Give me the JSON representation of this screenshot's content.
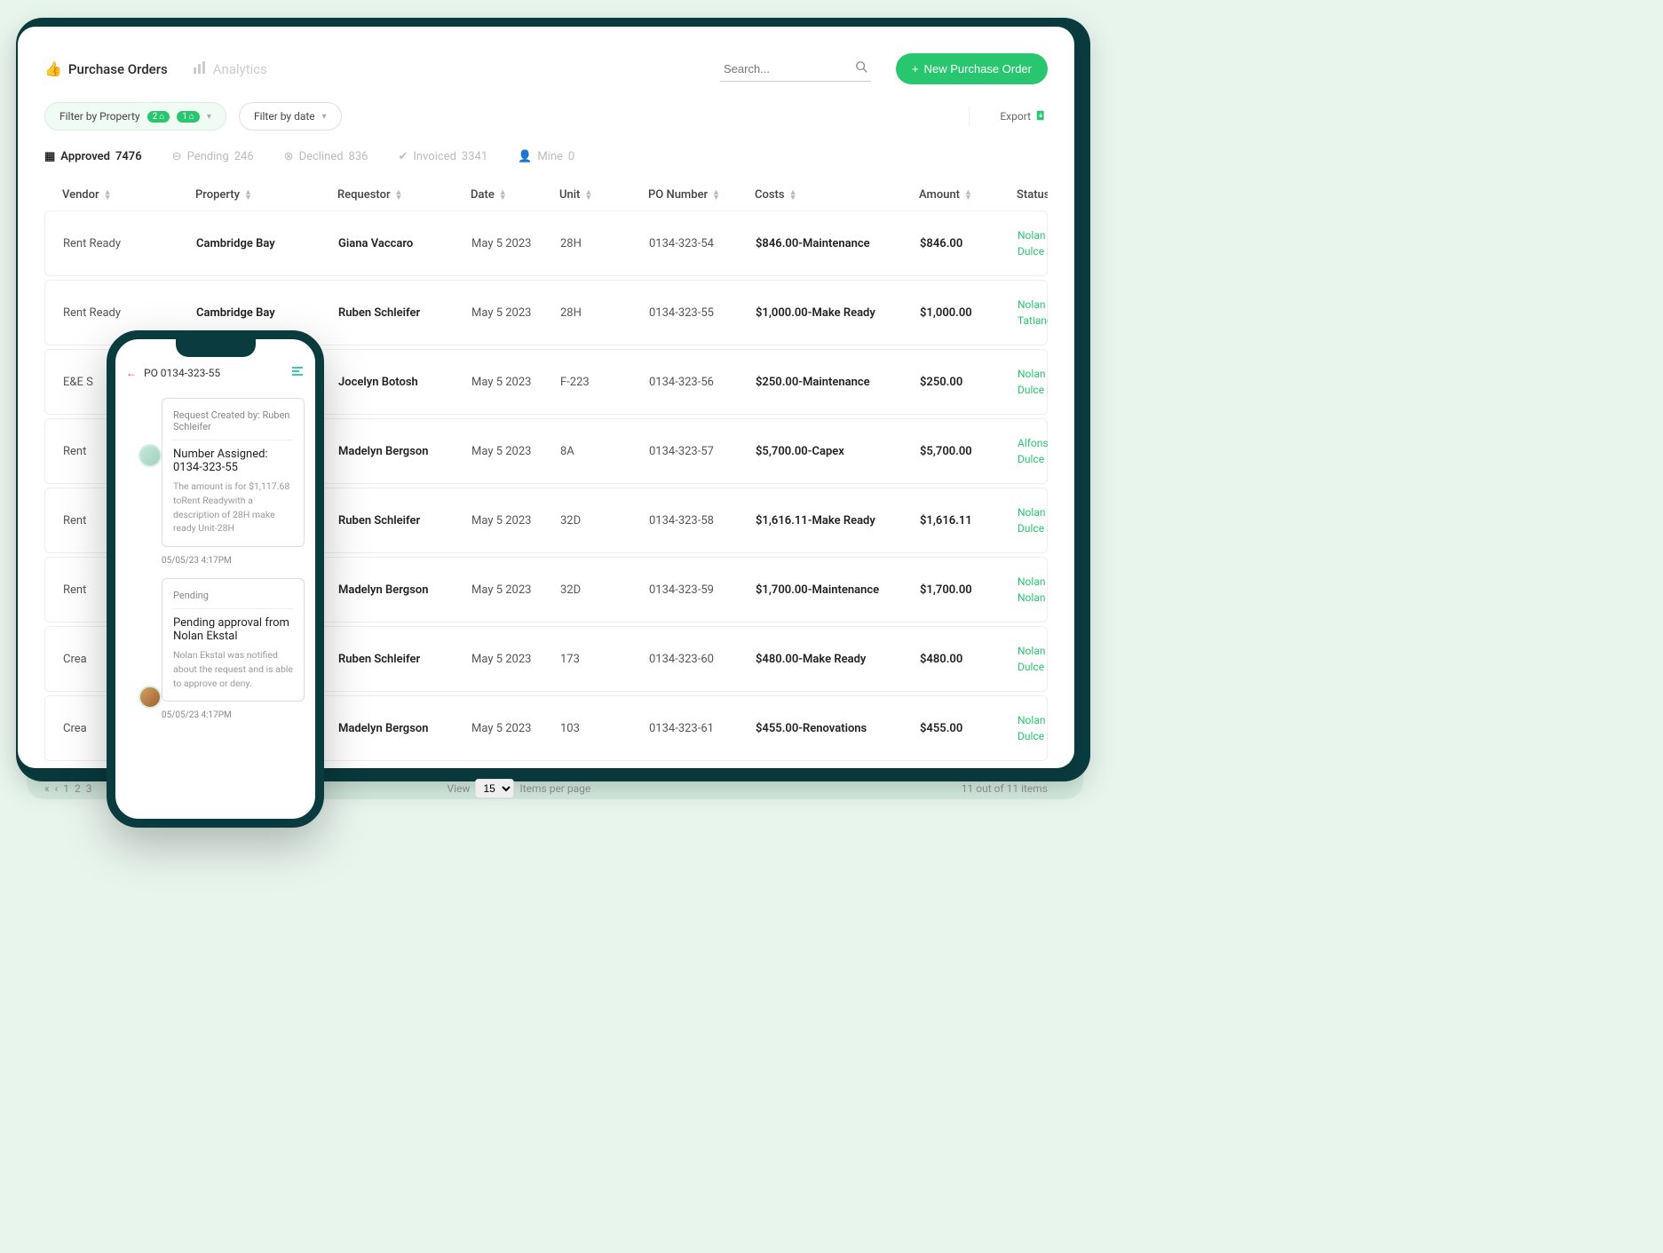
{
  "tabs": {
    "purchase_orders": "Purchase Orders",
    "analytics": "Analytics"
  },
  "search": {
    "placeholder": "Search..."
  },
  "new_button": "New Purchase Order",
  "filters": {
    "property": "Filter by Property",
    "property_badge1": "2",
    "property_badge2": "1",
    "date": "Filter by date"
  },
  "export_label": "Export",
  "status_tabs": [
    {
      "label": "Approved",
      "count": "7476"
    },
    {
      "label": "Pending",
      "count": "246"
    },
    {
      "label": "Declined",
      "count": "836"
    },
    {
      "label": "Invoiced",
      "count": "3341"
    },
    {
      "label": "Mine",
      "count": "0"
    }
  ],
  "columns": [
    "Vendor",
    "Property",
    "Requestor",
    "Date",
    "Unit",
    "PO Number",
    "Costs",
    "Amount",
    "Status"
  ],
  "rows": [
    {
      "vendor": "Rent Ready",
      "property": "Cambridge Bay",
      "requestor": "Giana Vaccaro",
      "date": "May 5 2023",
      "unit": "28H",
      "po": "0134-323-54",
      "costs": "$846.00-Maintenance",
      "amount": "$846.00",
      "status": [
        "Nolan E",
        "Dulce S"
      ]
    },
    {
      "vendor": "Rent Ready",
      "property": "Cambridge Bay",
      "requestor": "Ruben Schleifer",
      "date": "May 5 2023",
      "unit": "28H",
      "po": "0134-323-55",
      "costs": "$1,000.00-Make Ready",
      "amount": "$1,000.00",
      "status": [
        "Nolan E",
        "Tatianc"
      ]
    },
    {
      "vendor": "E&E S",
      "property": "",
      "requestor": "Jocelyn Botosh",
      "date": "May 5 2023",
      "unit": "F-223",
      "po": "0134-323-56",
      "costs": "$250.00-Maintenance",
      "amount": "$250.00",
      "status": [
        "Nolan E",
        "Dulce S"
      ]
    },
    {
      "vendor": "Rent",
      "property": "",
      "requestor": "Madelyn Bergson",
      "date": "May 5 2023",
      "unit": "8A",
      "po": "0134-323-57",
      "costs": "$5,700.00-Capex",
      "amount": "$5,700.00",
      "status": [
        "Alfonsc",
        "Dulce S"
      ]
    },
    {
      "vendor": "Rent",
      "property": "",
      "requestor": "Ruben Schleifer",
      "date": "May 5 2023",
      "unit": "32D",
      "po": "0134-323-58",
      "costs": "$1,616.11-Make Ready",
      "amount": "$1,616.11",
      "status": [
        "Nolan E",
        "Dulce S"
      ]
    },
    {
      "vendor": "Rent",
      "property": "",
      "requestor": "Madelyn Bergson",
      "date": "May 5 2023",
      "unit": "32D",
      "po": "0134-323-59",
      "costs": "$1,700.00-Maintenance",
      "amount": "$1,700.00",
      "status": [
        "Nolan E",
        "Nolan E"
      ]
    },
    {
      "vendor": "Crea",
      "property": "",
      "requestor": "Ruben Schleifer",
      "date": "May 5 2023",
      "unit": "173",
      "po": "0134-323-60",
      "costs": "$480.00-Make Ready",
      "amount": "$480.00",
      "status": [
        "Nolan E",
        "Dulce S"
      ]
    },
    {
      "vendor": "Crea",
      "property": "",
      "requestor": "Madelyn Bergson",
      "date": "May 5 2023",
      "unit": "103",
      "po": "0134-323-61",
      "costs": "$455.00-Renovations",
      "amount": "$455.00",
      "status": [
        "Nolan E",
        "Dulce S"
      ]
    }
  ],
  "pagination": {
    "pages": [
      "«",
      "‹",
      "1",
      "2",
      "3"
    ],
    "view_label": "View",
    "per_page": "15",
    "per_page_suffix": "Items per page",
    "total": "11 out of 11 items"
  },
  "phone": {
    "title": "PO  0134-323-55",
    "card1": {
      "header": "Request Created by: Ruben Schleifer",
      "title": "Number Assigned: 0134-323-55",
      "desc": "The amount is for $1,117.68 toRent Readywith a description of 28H make ready Unit-28H"
    },
    "ts1": "05/05/23 4:17PM",
    "card2": {
      "header": "Pending",
      "title": "Pending approval from Nolan Ekstal",
      "desc": "Nolan Ekstal was notified about the request and is able to approve or deny."
    },
    "ts2": "05/05/23 4:17PM"
  }
}
